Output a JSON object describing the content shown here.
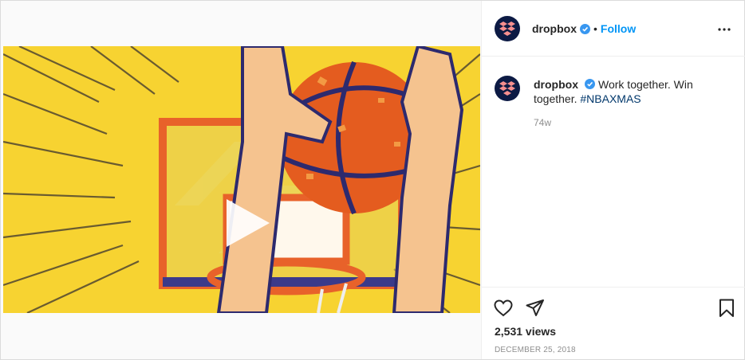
{
  "post": {
    "account": {
      "username": "dropbox",
      "verified": true,
      "follow_label": "Follow",
      "separator": "•"
    },
    "caption": {
      "username": "dropbox",
      "text": "Work together. Win together.",
      "hashtag": "#NBAXMAS",
      "age": "74w"
    },
    "media": {
      "type": "video",
      "play_icon": "play-icon"
    },
    "stats": {
      "views": "2,531 views",
      "date": "DECEMBER 25, 2018"
    },
    "icons": {
      "more": "more-options-icon",
      "like": "heart-icon",
      "share": "paper-plane-icon",
      "save": "bookmark-icon"
    },
    "colors": {
      "link": "#0095f6",
      "hashtag": "#00376b",
      "video_background": "#f7d331",
      "avatar": "#0c1a44",
      "brand": "#f78f8f"
    }
  }
}
